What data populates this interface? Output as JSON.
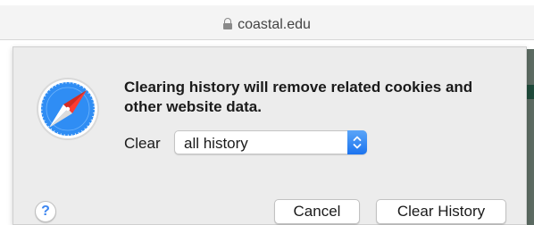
{
  "browser": {
    "url": "coastal.edu",
    "lock_icon": "lock-icon"
  },
  "dialog": {
    "app_icon": "safari-compass-icon",
    "message": "Clearing history will remove related cookies and other website data.",
    "clear_label": "Clear",
    "range_select": {
      "selected": "all history",
      "icon": "up-down-chevron-icon"
    },
    "help_label": "?",
    "cancel_label": "Cancel",
    "confirm_label": "Clear History"
  },
  "colors": {
    "accent": "#1c74ef",
    "sheet_background": "#ececec",
    "urlbar_background": "#f4f4f4"
  }
}
